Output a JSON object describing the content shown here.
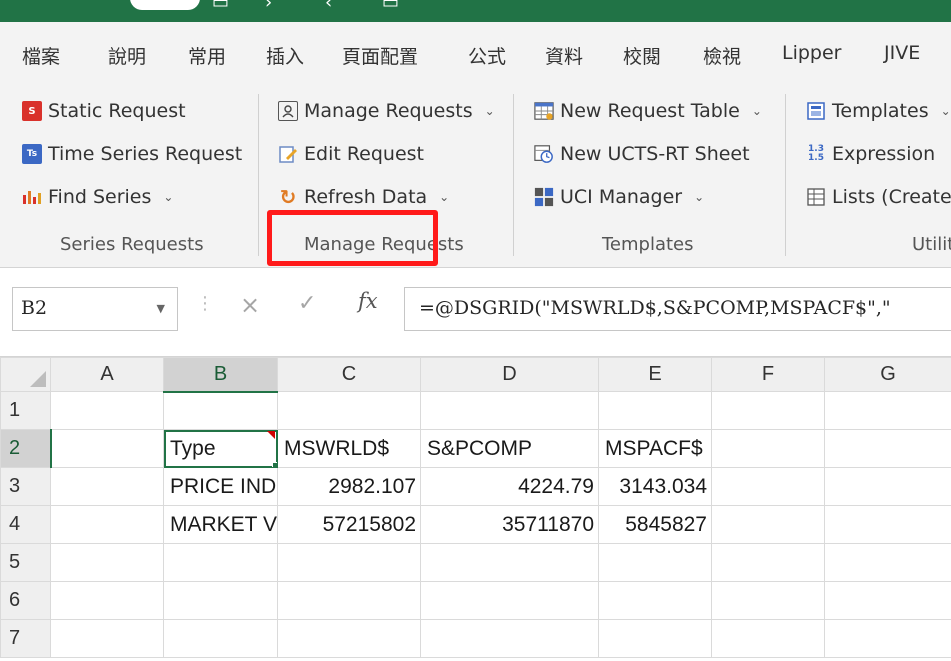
{
  "menu": [
    "檔案",
    "說明",
    "常用",
    "插入",
    "頁面配置",
    "公式",
    "資料",
    "校閱",
    "檢視",
    "Lipper",
    "JIVE"
  ],
  "ribbon": {
    "series_requests": {
      "static_request": "Static Request",
      "time_series_request": "Time Series Request",
      "find_series": "Find Series",
      "label": "Series Requests"
    },
    "manage_requests": {
      "manage_requests": "Manage Requests",
      "edit_request": "Edit Request",
      "refresh_data": "Refresh Data",
      "label": "Manage Requests"
    },
    "templates": {
      "new_request_table": "New Request Table",
      "new_ucts_rt_sheet": "New UCTS-RT Sheet",
      "uci_manager": "UCI Manager",
      "label": "Templates"
    },
    "utilities": {
      "templates": "Templates",
      "expression": "Expression",
      "lists": "Lists (Create f",
      "label": "Utilit"
    }
  },
  "formula_bar": {
    "name_box": "B2",
    "cancel_symbol": "×",
    "enter_symbol": "✓",
    "fx_label": "fx",
    "formula": "=@DSGRID(\"MSWRLD$,S&PCOMP,MSPACF$\",\""
  },
  "grid": {
    "columns": [
      "A",
      "B",
      "C",
      "D",
      "E",
      "F",
      "G"
    ],
    "rows": [
      {
        "n": "1",
        "cells": [
          "",
          "",
          "",
          "",
          "",
          "",
          ""
        ]
      },
      {
        "n": "2",
        "cells": [
          "",
          "Type",
          "MSWRLD$",
          "S&PCOMP",
          "MSPACF$",
          "",
          ""
        ]
      },
      {
        "n": "3",
        "cells": [
          "",
          "PRICE IND",
          "2982.107",
          "4224.79",
          "3143.034",
          "",
          ""
        ]
      },
      {
        "n": "4",
        "cells": [
          "",
          "MARKET V",
          "57215802",
          "35711870",
          "5845827",
          "",
          ""
        ]
      },
      {
        "n": "5",
        "cells": [
          "",
          "",
          "",
          "",
          "",
          "",
          ""
        ]
      },
      {
        "n": "6",
        "cells": [
          "",
          "",
          "",
          "",
          "",
          "",
          ""
        ]
      },
      {
        "n": "7",
        "cells": [
          "",
          "",
          "",
          "",
          "",
          "",
          ""
        ]
      }
    ],
    "active_cell": "B2"
  },
  "colors": {
    "excel_green": "#217346",
    "highlight_red": "#ff1a1a",
    "comment_indicator": "#d00000"
  },
  "icons": {
    "static_request": "static-request-icon",
    "time_series_request": "time-series-icon",
    "find_series": "find-series-icon",
    "manage_requests": "manage-requests-icon",
    "edit_request": "edit-request-icon",
    "refresh_data": "refresh-icon",
    "new_request_table": "request-table-icon",
    "new_ucts_rt_sheet": "ucts-sheet-icon",
    "uci_manager": "uci-manager-icon",
    "templates": "templates-icon",
    "expression": "expression-icon",
    "lists": "lists-icon"
  }
}
